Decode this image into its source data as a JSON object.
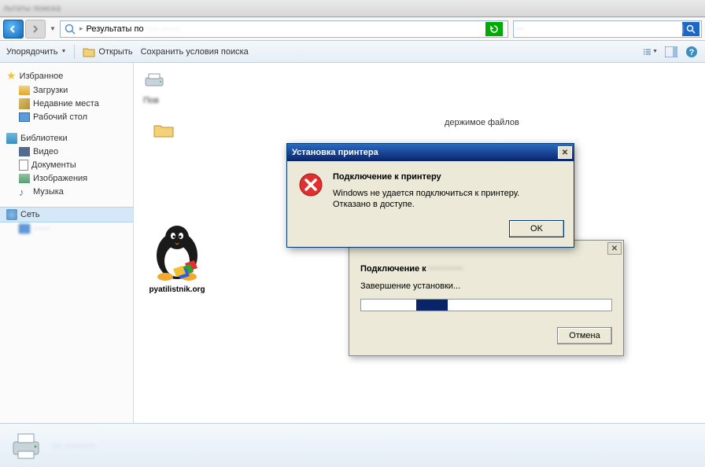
{
  "window": {
    "title_blurred": "льтаты поиска"
  },
  "navbar": {
    "breadcrumb_label": "Результаты по",
    "search_placeholder_blurred": "···"
  },
  "toolbar": {
    "organize": "Упорядочить",
    "open": "Открыть",
    "save_search": "Сохранить условия поиска"
  },
  "sidebar": {
    "favorites_title": "Избранное",
    "favorites": [
      {
        "label": "Загрузки"
      },
      {
        "label": "Недавние места"
      },
      {
        "label": "Рабочий стол"
      }
    ],
    "libraries_title": "Библиотеки",
    "libraries": [
      {
        "label": "Видео"
      },
      {
        "label": "Документы"
      },
      {
        "label": "Изображения"
      },
      {
        "label": "Музыка"
      }
    ],
    "network_title": "Сеть",
    "network_item_blurred": "······"
  },
  "content": {
    "partial_row_label": "Пов",
    "folder_hint_text": "держимое файлов"
  },
  "logo": {
    "site": "pyatilistnik.org"
  },
  "error_dialog": {
    "title": "Установка принтера",
    "heading": "Подключение к принтеру",
    "line1": "Windows не удается подключиться к принтеру.",
    "line2": "Отказано в доступе.",
    "ok": "OK"
  },
  "progress_dialog": {
    "connecting_to": "Подключение к",
    "target_blurred": "············",
    "status": "Завершение установки...",
    "cancel": "Отмена"
  },
  "detailsbar": {
    "blurred_text": "··· ·········"
  }
}
